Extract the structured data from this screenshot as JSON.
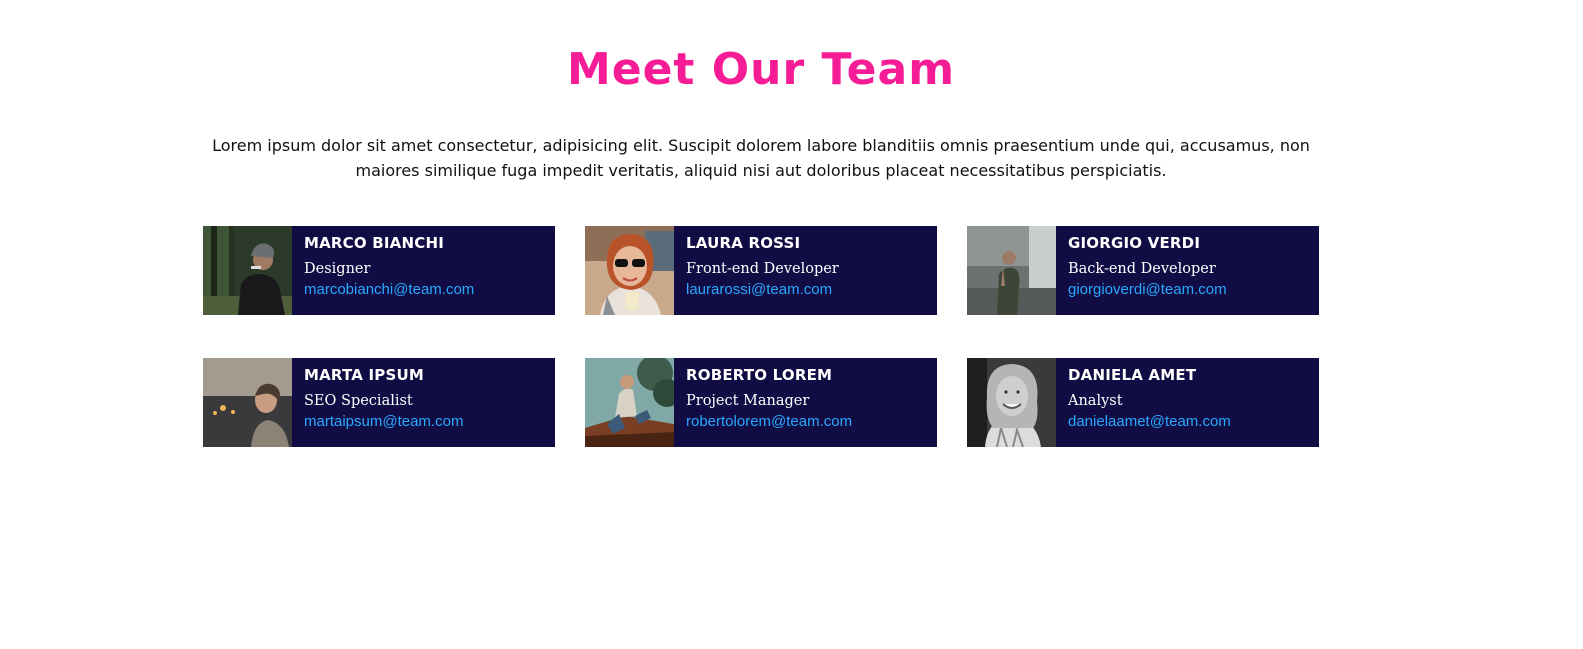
{
  "page": {
    "title": "Meet Our Team",
    "intro": "Lorem ipsum dolor sit amet consectetur, adipisicing elit. Suscipit dolorem labore blanditiis omnis praesentium unde qui, accusamus, non maiores similique fuga impedit veritatis, aliquid nisi aut doloribus placeat necessitatibus perspiciatis."
  },
  "colors": {
    "title": "#f51c96",
    "card_background": "#110d44",
    "email_link": "#29a8ff",
    "text_on_card": "#ffffff"
  },
  "team": [
    {
      "name": "MARCO BIANCHI",
      "role": "Designer",
      "email": "marcobianchi@team.com",
      "photo": "man-in-forest-photo"
    },
    {
      "name": "LAURA ROSSI",
      "role": "Front-end Developer",
      "email": "laurarossi@team.com",
      "photo": "woman-with-sunglasses-photo"
    },
    {
      "name": "GIORGIO VERDI",
      "role": "Back-end Developer",
      "email": "giorgioverdi@team.com",
      "photo": "man-by-waterfall-photo"
    },
    {
      "name": "MARTA IPSUM",
      "role": "SEO Specialist",
      "email": "martaipsum@team.com",
      "photo": "woman-by-lake-photo"
    },
    {
      "name": "ROBERTO LOREM",
      "role": "Project Manager",
      "email": "robertolorem@team.com",
      "photo": "man-sitting-on-roof-photo"
    },
    {
      "name": "DANIELA AMET",
      "role": "Analyst",
      "email": "danielaamet@team.com",
      "photo": "smiling-woman-photo"
    }
  ]
}
